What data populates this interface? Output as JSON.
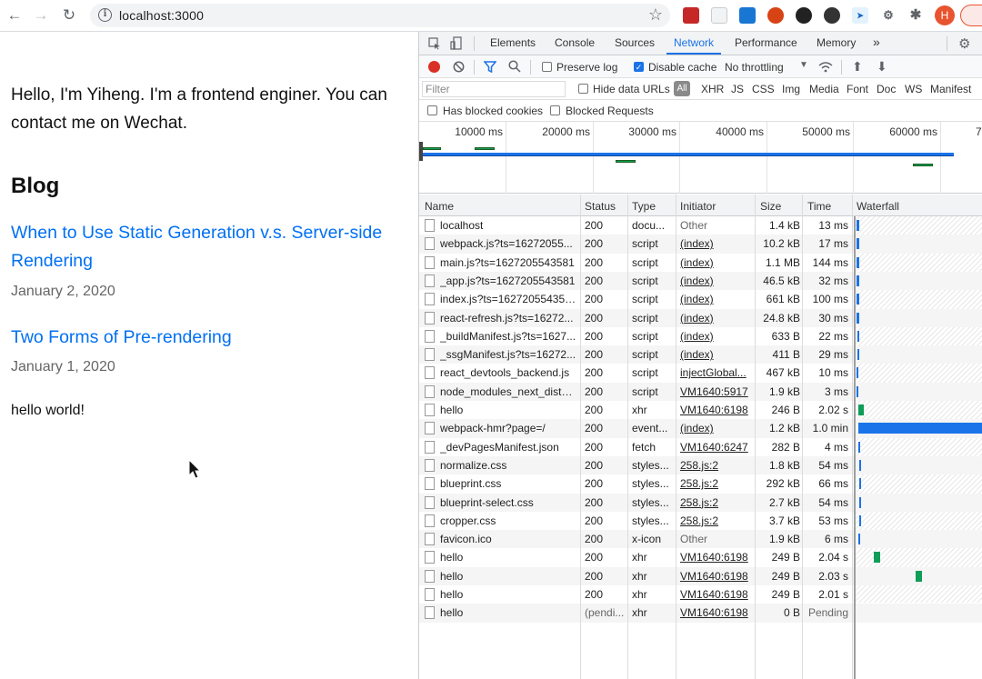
{
  "browser": {
    "url": "localhost:3000",
    "avatar_initial": "H"
  },
  "page": {
    "intro": "Hello, I'm Yiheng. I'm a frontend enginer. You can contact me on Wechat.",
    "blog_heading": "Blog",
    "posts": [
      {
        "title": "When to Use Static Generation v.s. Server-side Rendering",
        "date": "January 2, 2020"
      },
      {
        "title": "Two Forms of Pre-rendering",
        "date": "January 1, 2020"
      }
    ],
    "message": "hello world!"
  },
  "devtools": {
    "tabs": [
      "Elements",
      "Console",
      "Sources",
      "Network",
      "Performance",
      "Memory"
    ],
    "more_tabs": "»",
    "toolbar": {
      "preserve_log": "Preserve log",
      "disable_cache": "Disable cache",
      "throttling": "No throttling"
    },
    "filter": {
      "placeholder": "Filter",
      "hide_data_urls": "Hide data URLs",
      "all": "All",
      "types": [
        "XHR",
        "JS",
        "CSS",
        "Img",
        "Media",
        "Font",
        "Doc",
        "WS",
        "Manifest"
      ],
      "blocked_cookies": "Has blocked cookies",
      "blocked_requests": "Blocked Requests"
    },
    "overview_ticks": [
      "10000 ms",
      "20000 ms",
      "30000 ms",
      "40000 ms",
      "50000 ms",
      "60000 ms",
      "7"
    ],
    "columns": [
      "Name",
      "Status",
      "Type",
      "Initiator",
      "Size",
      "Time",
      "Waterfall"
    ],
    "requests": [
      {
        "name": "localhost",
        "status": "200",
        "type": "docu...",
        "initiator": "Other",
        "size": "1.4 kB",
        "time": "13 ms"
      },
      {
        "name": "webpack.js?ts=16272055...",
        "status": "200",
        "type": "script",
        "initiator": "(index)",
        "size": "10.2 kB",
        "time": "17 ms"
      },
      {
        "name": "main.js?ts=1627205543581",
        "status": "200",
        "type": "script",
        "initiator": "(index)",
        "size": "1.1 MB",
        "time": "144 ms"
      },
      {
        "name": "_app.js?ts=1627205543581",
        "status": "200",
        "type": "script",
        "initiator": "(index)",
        "size": "46.5 kB",
        "time": "32 ms"
      },
      {
        "name": "index.js?ts=1627205543581",
        "status": "200",
        "type": "script",
        "initiator": "(index)",
        "size": "661 kB",
        "time": "100 ms"
      },
      {
        "name": "react-refresh.js?ts=16272...",
        "status": "200",
        "type": "script",
        "initiator": "(index)",
        "size": "24.8 kB",
        "time": "30 ms"
      },
      {
        "name": "_buildManifest.js?ts=1627...",
        "status": "200",
        "type": "script",
        "initiator": "(index)",
        "size": "633 B",
        "time": "22 ms"
      },
      {
        "name": "_ssgManifest.js?ts=16272...",
        "status": "200",
        "type": "script",
        "initiator": "(index)",
        "size": "411 B",
        "time": "29 ms"
      },
      {
        "name": "react_devtools_backend.js",
        "status": "200",
        "type": "script",
        "initiator": "injectGlobal...",
        "size": "467 kB",
        "time": "10 ms"
      },
      {
        "name": "node_modules_next_dist_...",
        "status": "200",
        "type": "script",
        "initiator": "VM1640:5917",
        "size": "1.9 kB",
        "time": "3 ms"
      },
      {
        "name": "hello",
        "status": "200",
        "type": "xhr",
        "initiator": "VM1640:6198",
        "size": "246 B",
        "time": "2.02 s"
      },
      {
        "name": "webpack-hmr?page=/",
        "status": "200",
        "type": "event...",
        "initiator": "(index)",
        "size": "1.2 kB",
        "time": "1.0 min"
      },
      {
        "name": "_devPagesManifest.json",
        "status": "200",
        "type": "fetch",
        "initiator": "VM1640:6247",
        "size": "282 B",
        "time": "4 ms"
      },
      {
        "name": "normalize.css",
        "status": "200",
        "type": "styles...",
        "initiator": "258.js:2",
        "size": "1.8 kB",
        "time": "54 ms"
      },
      {
        "name": "blueprint.css",
        "status": "200",
        "type": "styles...",
        "initiator": "258.js:2",
        "size": "292 kB",
        "time": "66 ms"
      },
      {
        "name": "blueprint-select.css",
        "status": "200",
        "type": "styles...",
        "initiator": "258.js:2",
        "size": "2.7 kB",
        "time": "54 ms"
      },
      {
        "name": "cropper.css",
        "status": "200",
        "type": "styles...",
        "initiator": "258.js:2",
        "size": "3.7 kB",
        "time": "53 ms"
      },
      {
        "name": "favicon.ico",
        "status": "200",
        "type": "x-icon",
        "initiator": "Other",
        "size": "1.9 kB",
        "time": "6 ms"
      },
      {
        "name": "hello",
        "status": "200",
        "type": "xhr",
        "initiator": "VM1640:6198",
        "size": "249 B",
        "time": "2.04 s"
      },
      {
        "name": "hello",
        "status": "200",
        "type": "xhr",
        "initiator": "VM1640:6198",
        "size": "249 B",
        "time": "2.03 s"
      },
      {
        "name": "hello",
        "status": "200",
        "type": "xhr",
        "initiator": "VM1640:6198",
        "size": "249 B",
        "time": "2.01 s"
      },
      {
        "name": "hello",
        "status": "(pendi...",
        "type": "xhr",
        "initiator": "VM1640:6198",
        "size": "0 B",
        "time": "Pending"
      }
    ]
  }
}
